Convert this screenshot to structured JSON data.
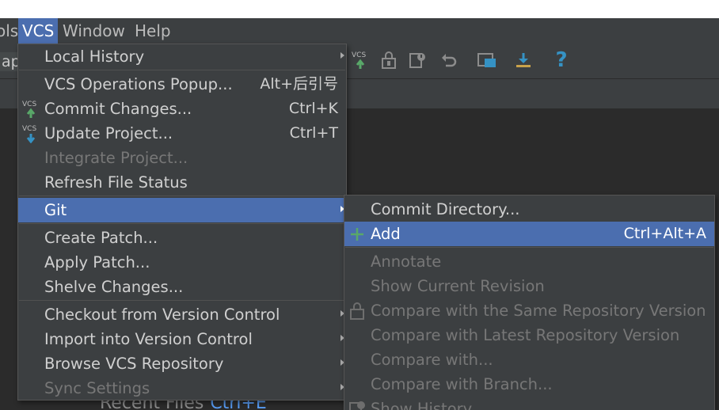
{
  "menubar": {
    "items": [
      {
        "label": "ols"
      },
      {
        "label": "VCS"
      },
      {
        "label": "Window"
      },
      {
        "label": "Help"
      }
    ]
  },
  "toolbar": {
    "breadcrumb": "ap",
    "icons": [
      "vcs-update-icon",
      "lock-icon",
      "annotate-icon",
      "revert-icon",
      "layout-icon",
      "download-icon",
      "help-icon"
    ],
    "vcs_badge": "VCS",
    "help_glyph": "?"
  },
  "editor": {
    "hint_label": "Recent Files",
    "hint_shortcut": "Ctrl+E"
  },
  "vcs_menu": {
    "items": [
      {
        "label": "Local History",
        "shortcut": "",
        "submenu": true,
        "disabled": false
      },
      {
        "label": "VCS Operations Popup...",
        "shortcut": "Alt+后引号",
        "submenu": false,
        "disabled": false
      },
      {
        "label": "Commit Changes...",
        "shortcut": "Ctrl+K",
        "submenu": false,
        "disabled": false,
        "icon": "vcs-commit-icon"
      },
      {
        "label": "Update Project...",
        "shortcut": "Ctrl+T",
        "submenu": false,
        "disabled": false,
        "icon": "vcs-update-icon"
      },
      {
        "label": "Integrate Project...",
        "shortcut": "",
        "submenu": false,
        "disabled": true
      },
      {
        "label": "Refresh File Status",
        "shortcut": "",
        "submenu": false,
        "disabled": false
      },
      {
        "label": "Git",
        "shortcut": "",
        "submenu": true,
        "disabled": false,
        "selected": true
      },
      {
        "label": "Create Patch...",
        "shortcut": "",
        "submenu": false,
        "disabled": false
      },
      {
        "label": "Apply Patch...",
        "shortcut": "",
        "submenu": false,
        "disabled": false
      },
      {
        "label": "Shelve Changes...",
        "shortcut": "",
        "submenu": false,
        "disabled": false
      },
      {
        "label": "Checkout from Version Control",
        "shortcut": "",
        "submenu": true,
        "disabled": false
      },
      {
        "label": "Import into Version Control",
        "shortcut": "",
        "submenu": true,
        "disabled": false
      },
      {
        "label": "Browse VCS Repository",
        "shortcut": "",
        "submenu": true,
        "disabled": false
      },
      {
        "label": "Sync Settings",
        "shortcut": "",
        "submenu": true,
        "disabled": true
      }
    ]
  },
  "git_menu": {
    "items": [
      {
        "label": "Commit Directory...",
        "shortcut": "",
        "disabled": false
      },
      {
        "label": "Add",
        "shortcut": "Ctrl+Alt+A",
        "disabled": false,
        "selected": true,
        "icon": "plus-icon"
      },
      {
        "label": "Annotate",
        "shortcut": "",
        "disabled": true
      },
      {
        "label": "Show Current Revision",
        "shortcut": "",
        "disabled": true
      },
      {
        "label": "Compare with the Same Repository Version",
        "shortcut": "",
        "disabled": true,
        "icon": "compare-icon"
      },
      {
        "label": "Compare with Latest Repository Version",
        "shortcut": "",
        "disabled": true
      },
      {
        "label": "Compare with...",
        "shortcut": "",
        "disabled": true
      },
      {
        "label": "Compare with Branch...",
        "shortcut": "",
        "disabled": true
      },
      {
        "label": "Show History",
        "shortcut": "",
        "disabled": true,
        "icon": "history-icon"
      }
    ]
  },
  "colors": {
    "menu_bg": "#3c3f41",
    "selection": "#4b6eaf",
    "editor_bg": "#2b2b2b",
    "accent_green": "#59a869",
    "accent_blue": "#3592c4"
  }
}
